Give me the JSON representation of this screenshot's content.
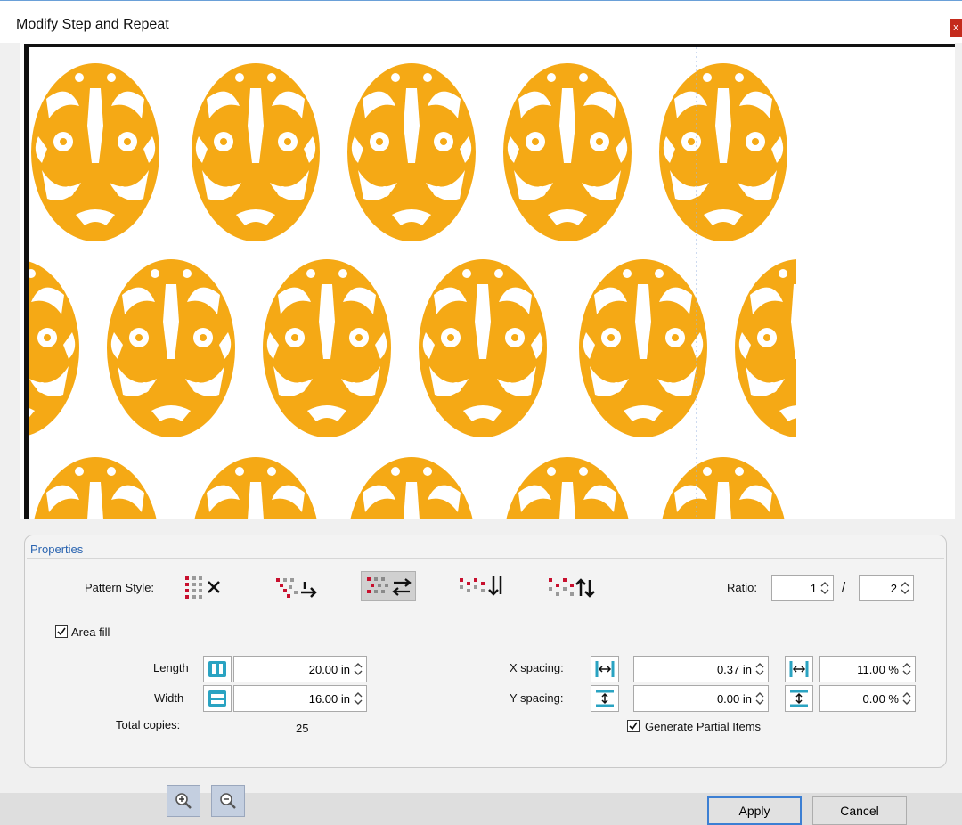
{
  "window": {
    "title": "Modify Step and Repeat",
    "close_glyph": "x"
  },
  "preview": {
    "motif_color": "#f5a915",
    "motif_icon": "damask-icon",
    "rows": 3
  },
  "properties": {
    "title": "Properties",
    "pattern_style_label": "Pattern Style:",
    "pattern_styles": [
      {
        "icon": "pattern-grid-icon",
        "glyph": "✕",
        "selected": false
      },
      {
        "icon": "pattern-offset-right-icon",
        "glyph": "⭢",
        "selected": false
      },
      {
        "icon": "pattern-offset-alternate-icon",
        "glyph": "⇄",
        "selected": true
      },
      {
        "icon": "pattern-offset-down-icon",
        "glyph": "↓",
        "selected": false
      },
      {
        "icon": "pattern-offset-updown-icon",
        "glyph": "⇅",
        "selected": false
      }
    ],
    "ratio_label": "Ratio:",
    "ratio_numerator": "1",
    "ratio_separator": "/",
    "ratio_denominator": "2",
    "area_fill_label": "Area fill",
    "area_fill_checked": true,
    "length_label": "Length",
    "length_value": "20.00 in",
    "width_label": "Width",
    "width_value": "16.00 in",
    "total_copies_label": "Total copies:",
    "total_copies_value": "25",
    "x_spacing_label": "X spacing:",
    "x_spacing_value": "0.37 in",
    "x_spacing_percent": "11.00 %",
    "y_spacing_label": "Y spacing:",
    "y_spacing_value": "0.00 in",
    "y_spacing_percent": "0.00 %",
    "generate_partial_label": "Generate Partial Items",
    "generate_partial_checked": true
  },
  "footer": {
    "zoom_in_icon": "zoom-in-icon",
    "zoom_out_icon": "zoom-out-icon",
    "apply_label": "Apply",
    "cancel_label": "Cancel"
  }
}
